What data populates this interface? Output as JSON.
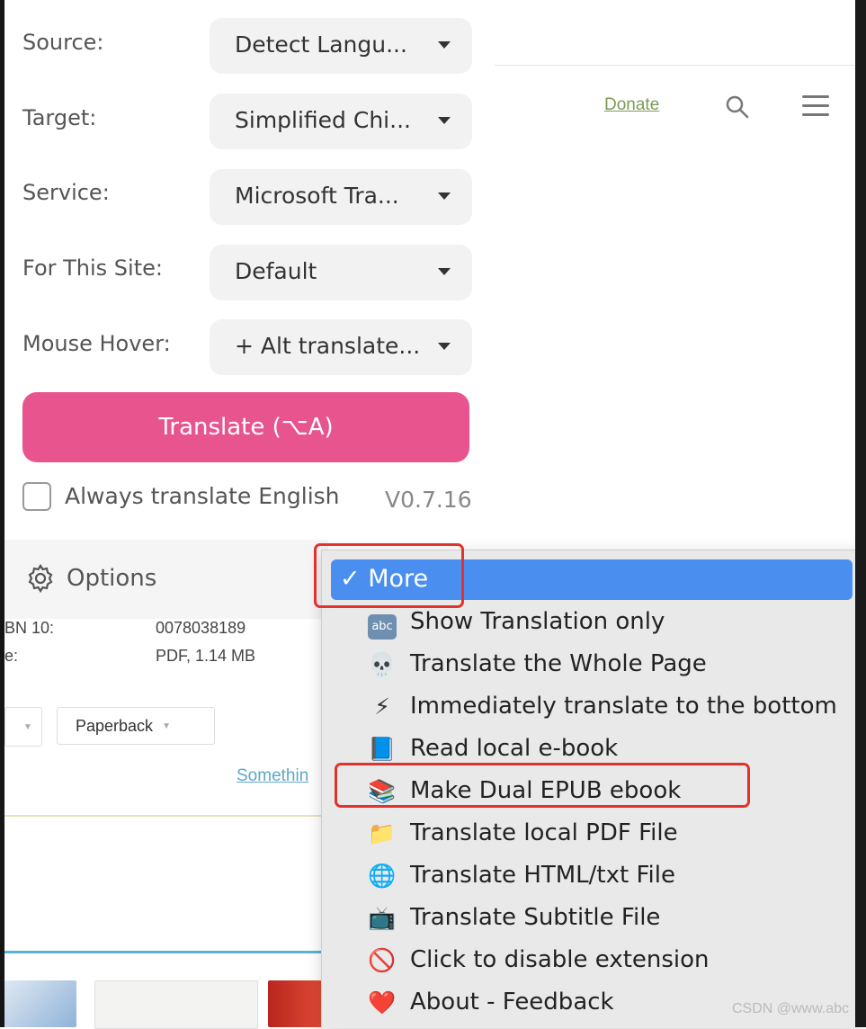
{
  "popup": {
    "fields": [
      {
        "label": "Source:",
        "value": "Detect Langu..."
      },
      {
        "label": "Target:",
        "value": "Simplified Chi..."
      },
      {
        "label": "Service:",
        "value": "Microsoft Tra..."
      },
      {
        "label": "For This Site:",
        "value": "Default"
      },
      {
        "label": "Mouse Hover:",
        "value": "+ Alt translate..."
      }
    ],
    "translate_button": "Translate (⌥A)",
    "always_translate_label": "Always translate English",
    "version": "V0.7.16",
    "options_label": "Options"
  },
  "menu": {
    "selected": "✓ More",
    "items": [
      {
        "icon": "abc",
        "label": "Show Translation only"
      },
      {
        "icon": "💀",
        "label": "Translate the Whole Page"
      },
      {
        "icon": "⚡",
        "label": "Immediately translate to the bottom"
      },
      {
        "icon": "📘",
        "label": "Read local e-book"
      },
      {
        "icon": "📚",
        "label": "Make Dual EPUB ebook"
      },
      {
        "icon": "📁",
        "label": "Translate local PDF File"
      },
      {
        "icon": "🌐",
        "label": "Translate HTML/txt File"
      },
      {
        "icon": "📺",
        "label": "Translate Subtitle File"
      },
      {
        "icon": "🚫",
        "label": "Click to disable extension"
      },
      {
        "icon": "❤️",
        "label": "About - Feedback"
      }
    ]
  },
  "background": {
    "donate": "Donate",
    "isbn_label": "BN 10:",
    "isbn_value": "0078038189",
    "file_label": "e:",
    "file_value": "PDF, 1.14 MB",
    "format_select": "Paperback",
    "link_text": "Somethin"
  },
  "watermark": "CSDN @www.abc"
}
